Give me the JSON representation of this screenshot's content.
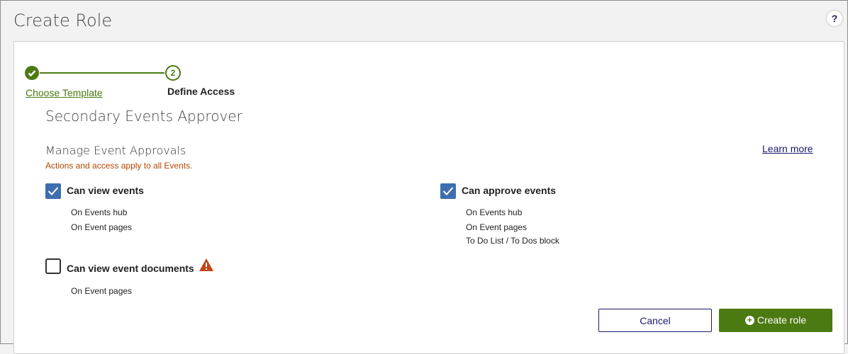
{
  "header": {
    "title": "Create Role",
    "help_label": "?"
  },
  "steps": [
    {
      "number": "1",
      "label": "Choose Template",
      "state": "completed"
    },
    {
      "number": "2",
      "label": "Define Access",
      "state": "active"
    }
  ],
  "role_name": "Secondary Events Approver",
  "section": {
    "title": "Manage Event Approvals",
    "note": "Actions and access apply to all Events.",
    "learn_more": "Learn more"
  },
  "permissions": [
    {
      "label": "Can view events",
      "checked": true,
      "details": [
        "On Events hub",
        "On Event pages"
      ]
    },
    {
      "label": "Can approve events",
      "checked": true,
      "details": [
        "On Events hub",
        "On Event pages",
        "To Do List / To Dos block"
      ]
    },
    {
      "label": "Can view event documents",
      "checked": false,
      "warning": true,
      "details": [
        "On Event pages"
      ]
    }
  ],
  "buttons": {
    "cancel": "Cancel",
    "create": "Create role"
  },
  "colors": {
    "accent_green": "#4c7a12",
    "checkbox_blue": "#3d6fb0",
    "note_orange": "#b34700",
    "link_navy": "#1a1a6e",
    "warning": "#c0461a"
  }
}
